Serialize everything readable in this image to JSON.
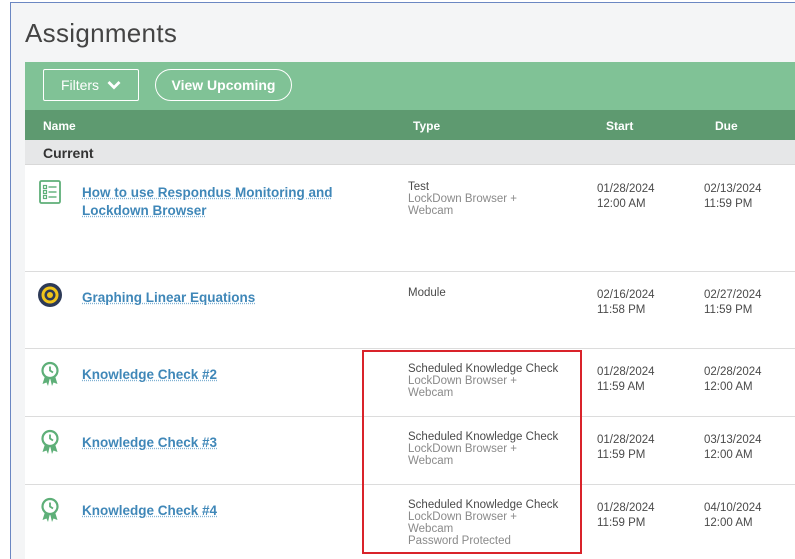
{
  "page": {
    "title": "Assignments"
  },
  "toolbar": {
    "filters_label": "Filters",
    "view_upcoming_label": "View Upcoming"
  },
  "table": {
    "columns": {
      "name": "Name",
      "type": "Type",
      "start": "Start",
      "due": "Due"
    },
    "section": "Current",
    "rows": [
      {
        "icon": "checklist-icon",
        "name": "How to use Respondus Monitoring and Lockdown Browser",
        "type": "Test",
        "details": [
          "LockDown Browser +",
          "Webcam"
        ],
        "start_date": "01/28/2024",
        "start_time": "12:00 AM",
        "due_date": "02/13/2024",
        "due_time": "11:59 PM"
      },
      {
        "icon": "module-target-icon",
        "name": "Graphing Linear Equations",
        "type": "Module",
        "details": [],
        "start_date": "02/16/2024",
        "start_time": "11:58 PM",
        "due_date": "02/27/2024",
        "due_time": "11:59 PM"
      },
      {
        "icon": "award-ribbon-icon",
        "name": "Knowledge Check #2",
        "type": "Scheduled Knowledge Check",
        "details": [
          "LockDown Browser +",
          "Webcam"
        ],
        "start_date": "01/28/2024",
        "start_time": "11:59 AM",
        "due_date": "02/28/2024",
        "due_time": "12:00 AM"
      },
      {
        "icon": "award-ribbon-icon",
        "name": "Knowledge Check #3",
        "type": "Scheduled Knowledge Check",
        "details": [
          "LockDown Browser +",
          "Webcam"
        ],
        "start_date": "01/28/2024",
        "start_time": "11:59 PM",
        "due_date": "03/13/2024",
        "due_time": "12:00 AM"
      },
      {
        "icon": "award-ribbon-icon",
        "name": "Knowledge Check #4",
        "type": "Scheduled Knowledge Check",
        "details": [
          "LockDown Browser +",
          "Webcam",
          "Password Protected"
        ],
        "start_date": "01/28/2024",
        "start_time": "11:59 PM",
        "due_date": "04/10/2024",
        "due_time": "12:00 AM"
      }
    ]
  },
  "colors": {
    "toolbar": "#80c296",
    "header": "#5e9a70",
    "link": "#3f87b8",
    "highlight": "#d9232a"
  }
}
